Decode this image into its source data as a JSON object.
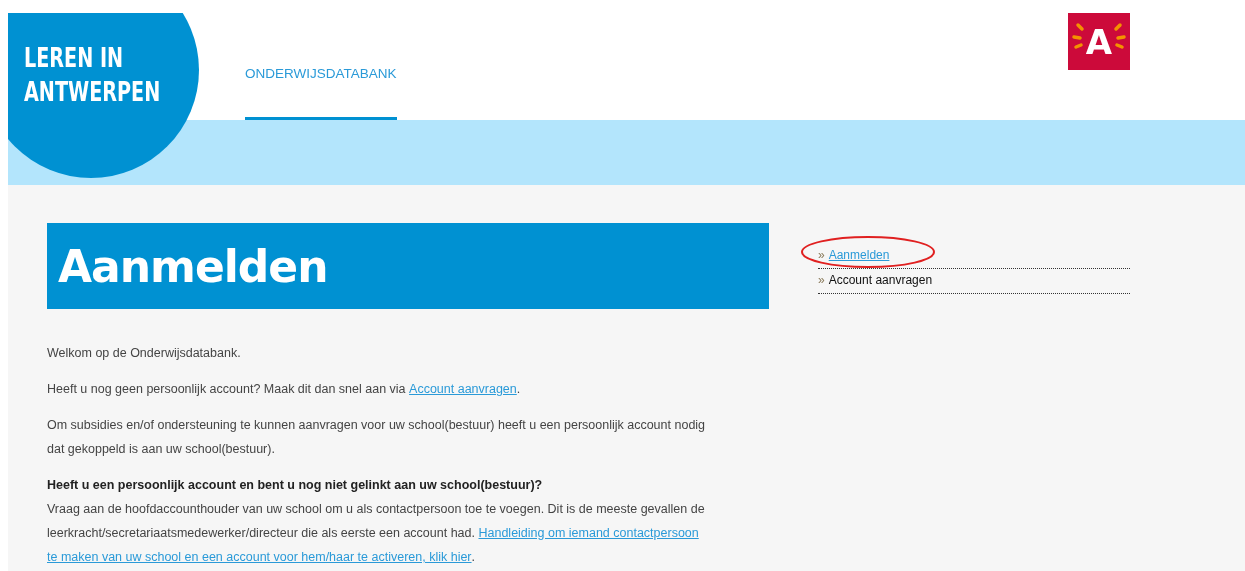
{
  "header": {
    "brand_lines": [
      "LEREN IN",
      "ANTWERPEN"
    ],
    "nav": [
      {
        "label": "ONDERWIJSDATABANK",
        "selected": true
      }
    ],
    "city_logo": {
      "letter": "A"
    }
  },
  "main": {
    "title": "Aanmelden",
    "paragraphs": [
      {
        "kind": "plain",
        "parts": [
          {
            "kind": "text",
            "text": "Welkom op de Onderwijsdatabank."
          }
        ]
      },
      {
        "kind": "plain",
        "parts": [
          {
            "kind": "text",
            "text": "Heeft u nog geen persoonlijk account? Maak dit dan snel aan via "
          },
          {
            "kind": "link",
            "text": "Account aanvragen"
          },
          {
            "kind": "text",
            "text": "."
          }
        ]
      },
      {
        "kind": "plain",
        "parts": [
          {
            "kind": "text",
            "text": "Om subsidies en/of ondersteuning te kunnen aanvragen voor uw school(bestuur) heeft u een persoonlijk account nodig dat gekoppeld is aan uw school(bestuur)."
          }
        ]
      },
      {
        "kind": "headed",
        "heading": "Heeft u een persoonlijk account en bent u nog niet gelinkt aan uw school(bestuur)?",
        "parts": [
          {
            "kind": "text",
            "text": "Vraag aan de hoofdaccounthouder van uw school om u als contactpersoon toe te voegen. Dit is de meeste gevallen de leerkracht/secretariaatsmedewerker/directeur die als eerste een account had. "
          },
          {
            "kind": "link",
            "text": "Handleiding om iemand contactpersoon"
          },
          {
            "kind": "link",
            "text": "te maken van uw school en een account voor hem/haar te activeren, klik hier"
          },
          {
            "kind": "text",
            "text": "."
          }
        ]
      }
    ]
  },
  "sidebar": {
    "items": [
      {
        "marker": "»",
        "label": "Aanmelden",
        "selected": true,
        "circled": true
      },
      {
        "marker": "»",
        "label": "Account aanvragen",
        "selected": false,
        "circled": false
      }
    ]
  }
}
